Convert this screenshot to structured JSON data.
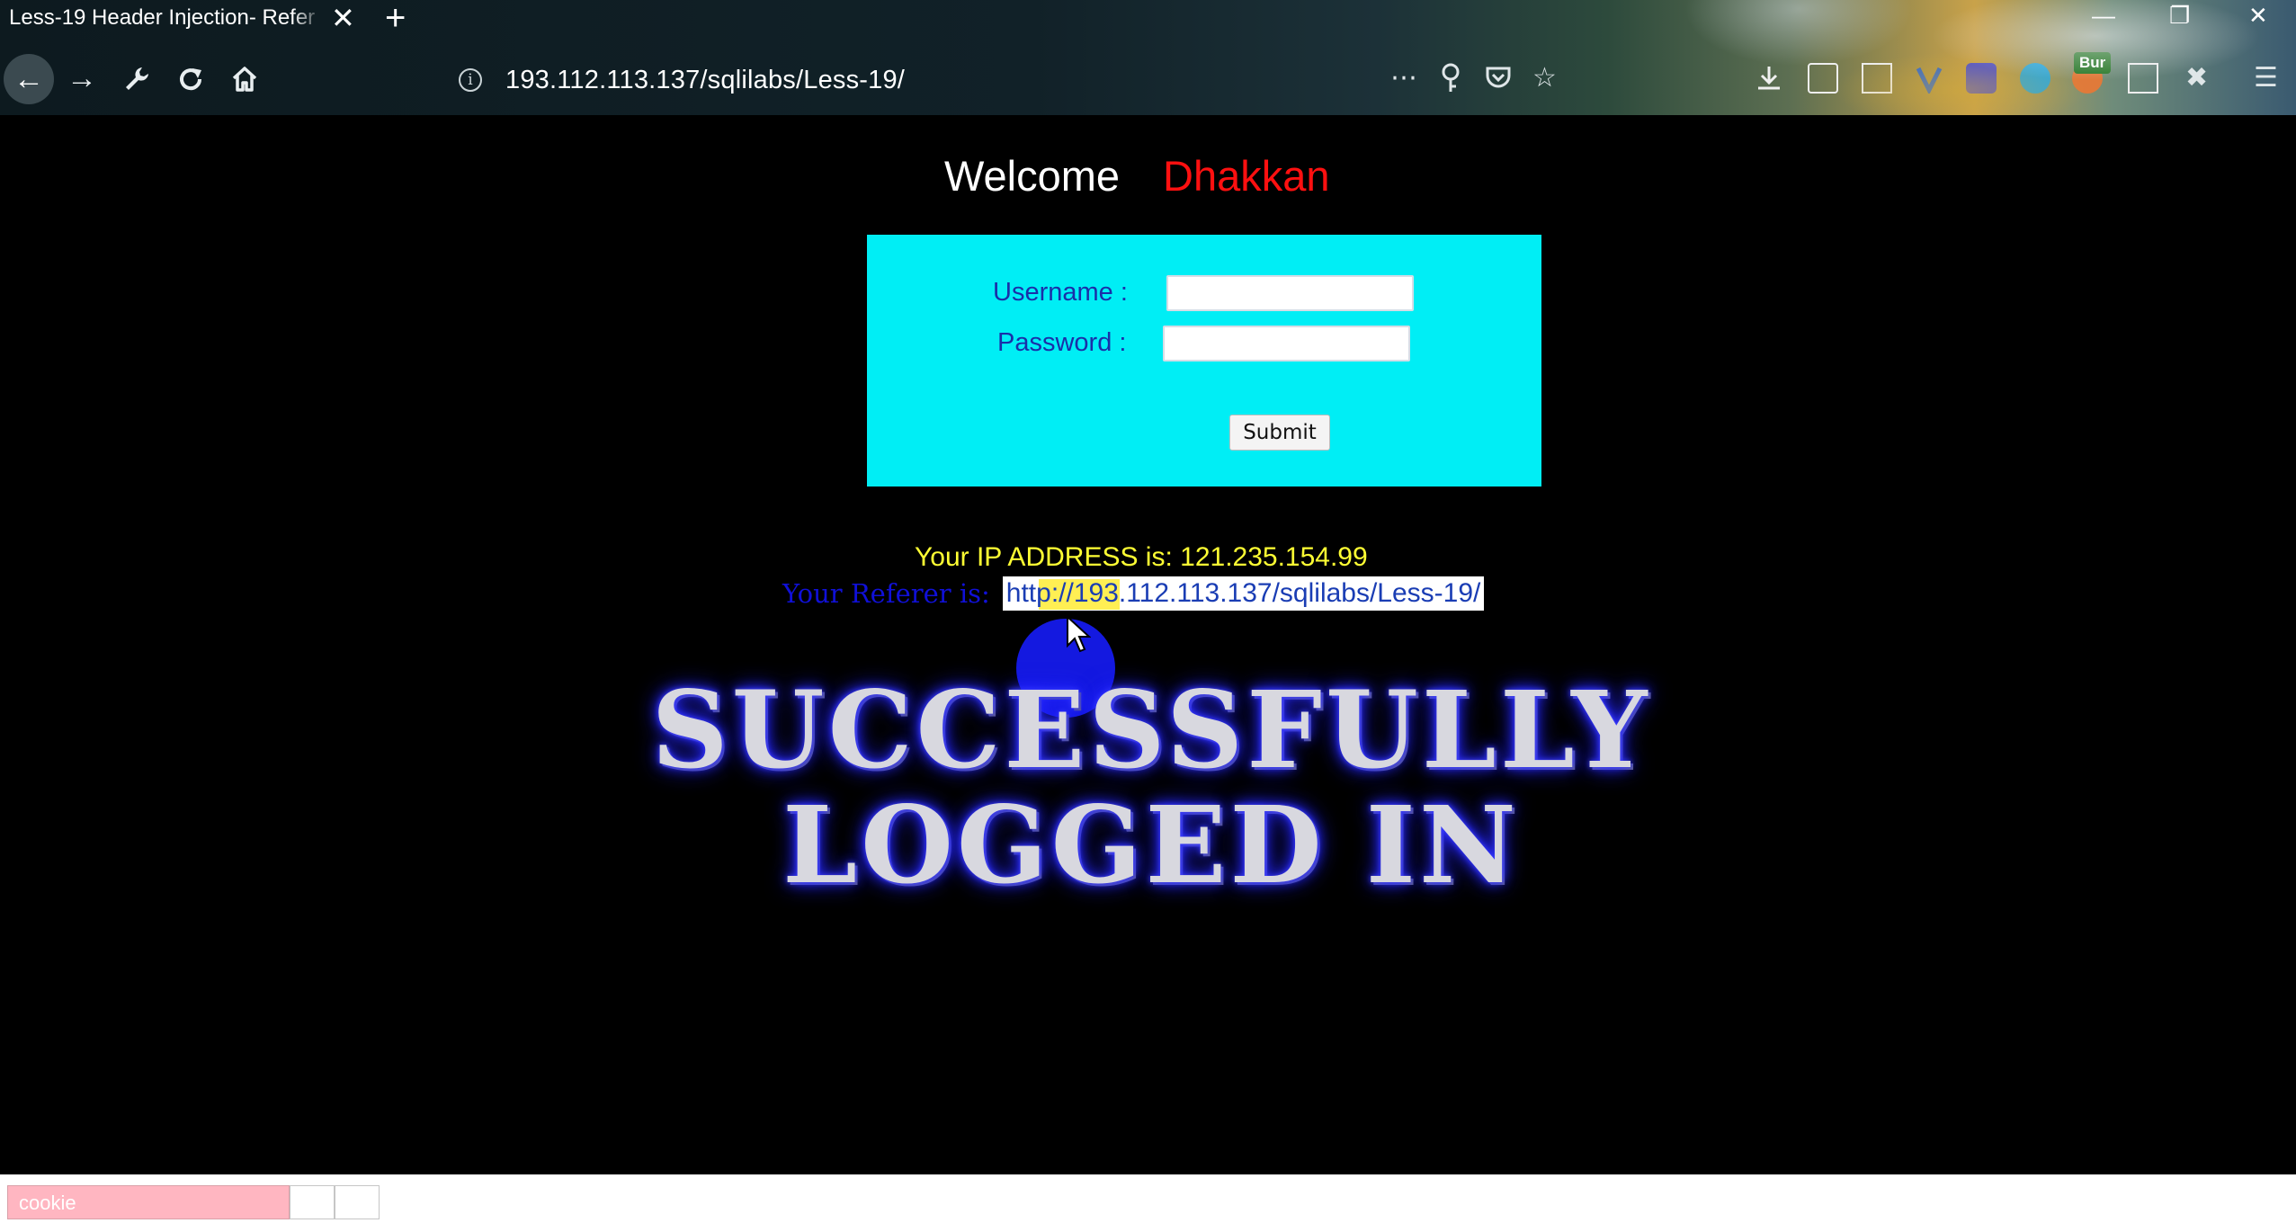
{
  "browser": {
    "tab_title": "Less-19 Header Injection- Refer",
    "tab_close": "✕",
    "new_tab": "+",
    "url": "193.112.113.137/sqlilabs/Less-19/",
    "burp_badge": "Bur",
    "icons": {
      "back": "back-arrow-icon",
      "forward": "forward-arrow-icon",
      "tools": "wrench-icon",
      "reload": "reload-icon",
      "home": "home-icon",
      "info": "info-icon",
      "more": "ellipsis-icon",
      "key": "key-icon",
      "pocket": "pocket-icon",
      "bookmark": "star-icon"
    }
  },
  "page": {
    "welcome_label": "Welcome",
    "welcome_user": "Dhakkan",
    "form": {
      "username_label": "Username :",
      "password_label": "Password :",
      "username_value": "",
      "password_value": "",
      "submit_label": "Submit"
    },
    "ip_line": "Your IP ADDRESS is: 121.235.154.99",
    "referer_label": "Your Referer is:",
    "referer_value": "http://193.112.113.137/sqlilabs/Less-19/",
    "success_line1": "SUCCESSFULLY",
    "success_line2": "LOGGED IN"
  },
  "bottom_bar": {
    "cookie_placeholder": "cookie"
  },
  "colors": {
    "welcome_user": "#ff1010",
    "login_box": "#00eef5",
    "ip_text": "#ffff33",
    "referer_label": "#1010d8",
    "cookie_field": "#ffb6c1"
  }
}
